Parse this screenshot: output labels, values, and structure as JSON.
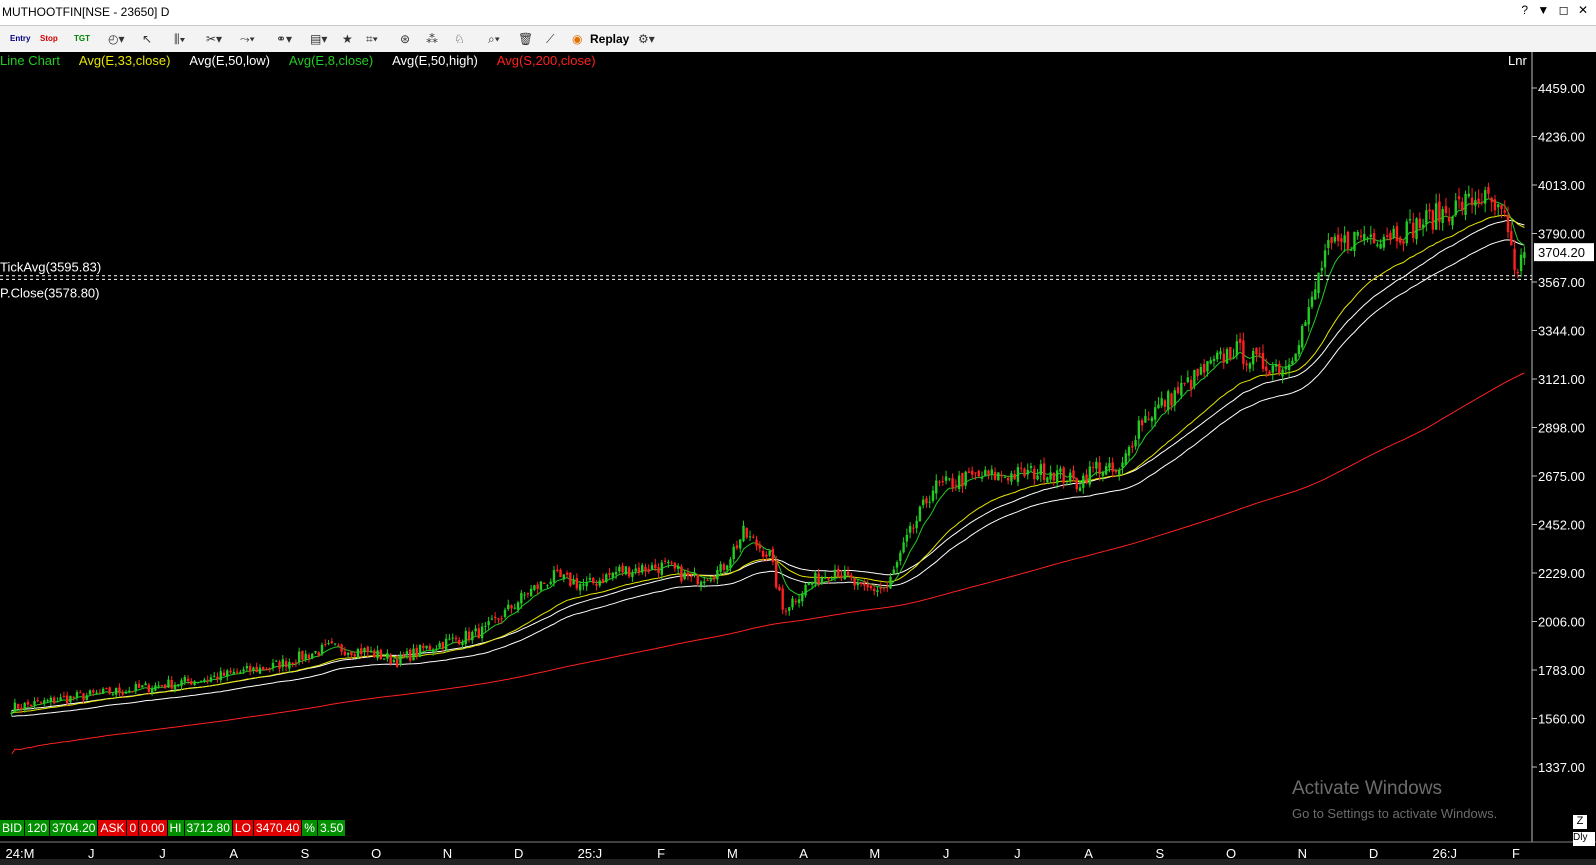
{
  "window": {
    "title": "MUTHOOTFIN[NSE - 23650] D",
    "controls": [
      "?",
      "▼",
      "◻",
      "✕"
    ]
  },
  "toolbar": {
    "entry_label": "Entry",
    "stop_label": "Stop",
    "tgt_label": "TGT",
    "replay_label": "Replay"
  },
  "legend": {
    "chart_type": "Line Chart",
    "avg1": "Avg(E,33,close)",
    "avg2": "Avg(E,50,low)",
    "avg3": "Avg(E,8,close)",
    "avg4": "Avg(E,50,high)",
    "avg5": "Avg(S,200,close)",
    "scale": "Lnr"
  },
  "colors": {
    "up": "#22cc22",
    "down": "#ff2020",
    "ema33": "#e6e600",
    "ema50low": "#ffffff",
    "ema8": "#22cc22",
    "ema50high": "#ffffff",
    "sma200": "#ff2020"
  },
  "ticker": {
    "bid_label": "BID",
    "bid_qty": "120",
    "bid_price": "3704.20",
    "ask_label": "ASK",
    "ask_qty": "0",
    "ask_price": "0.00",
    "hi_label": "HI",
    "hi_value": "3712.80",
    "lo_label": "LO",
    "lo_value": "3470.40",
    "pct_label": "%",
    "pct_value": "3.50"
  },
  "watermark": {
    "line1": "Activate Windows",
    "line2": "Go to Settings to activate Windows."
  },
  "chart_data": {
    "type": "line",
    "symbol": "MUTHOOTFIN",
    "y_ticks": [
      4459,
      4236,
      4013,
      3790,
      3567,
      3344,
      3121,
      2898,
      2675,
      2452,
      2229,
      2006,
      1783,
      1560,
      1337
    ],
    "y_tick_labels": [
      "4459.00",
      "4236.00",
      "4013.00",
      "3790.00",
      "3567.00",
      "3344.00",
      "3121.00",
      "2898.00",
      "2675.00",
      "2452.00",
      "2229.00",
      "2006.00",
      "1783.00",
      "1560.00",
      "1337.00"
    ],
    "ylim": [
      1200,
      4600
    ],
    "x_tick_labels": [
      "24:M",
      "J",
      "J",
      "A",
      "S",
      "O",
      "N",
      "D",
      "25:J",
      "F",
      "M",
      "A",
      "M",
      "J",
      "J",
      "A",
      "S",
      "O",
      "N",
      "D",
      "26:J",
      "F"
    ],
    "last_price": 3704.2,
    "last_price_label": "3704.20",
    "tick_avg": 3595.83,
    "tick_avg_label": "TickAvg(3595.83)",
    "prev_close": 3578.8,
    "prev_close_label": "P.Close(3578.80)",
    "close_anchors": [
      [
        0,
        1610
      ],
      [
        20,
        1660
      ],
      [
        40,
        1700
      ],
      [
        60,
        1745
      ],
      [
        80,
        1800
      ],
      [
        97,
        1885
      ],
      [
        108,
        1870
      ],
      [
        118,
        1825
      ],
      [
        126,
        1880
      ],
      [
        145,
        1965
      ],
      [
        158,
        2140
      ],
      [
        166,
        2210
      ],
      [
        176,
        2170
      ],
      [
        186,
        2240
      ],
      [
        200,
        2260
      ],
      [
        208,
        2200
      ],
      [
        217,
        2240
      ],
      [
        224,
        2410
      ],
      [
        232,
        2310
      ],
      [
        236,
        2060
      ],
      [
        244,
        2180
      ],
      [
        252,
        2250
      ],
      [
        260,
        2150
      ],
      [
        268,
        2160
      ],
      [
        274,
        2380
      ],
      [
        282,
        2620
      ],
      [
        294,
        2670
      ],
      [
        306,
        2680
      ],
      [
        318,
        2700
      ],
      [
        326,
        2640
      ],
      [
        332,
        2720
      ],
      [
        339,
        2680
      ],
      [
        345,
        2920
      ],
      [
        360,
        3100
      ],
      [
        374,
        3260
      ],
      [
        382,
        3190
      ],
      [
        390,
        3180
      ],
      [
        397,
        3420
      ],
      [
        402,
        3700
      ],
      [
        412,
        3780
      ],
      [
        426,
        3800
      ],
      [
        440,
        3900
      ],
      [
        450,
        3960
      ],
      [
        457,
        3850
      ],
      [
        460,
        3600
      ],
      [
        463,
        3704
      ]
    ],
    "total_bars": 464,
    "series": [
      {
        "name": "Avg(E,33,close)"
      },
      {
        "name": "Avg(E,50,low)"
      },
      {
        "name": "Avg(E,8,close)"
      },
      {
        "name": "Avg(E,50,high)"
      },
      {
        "name": "Avg(S,200,close)"
      }
    ]
  }
}
